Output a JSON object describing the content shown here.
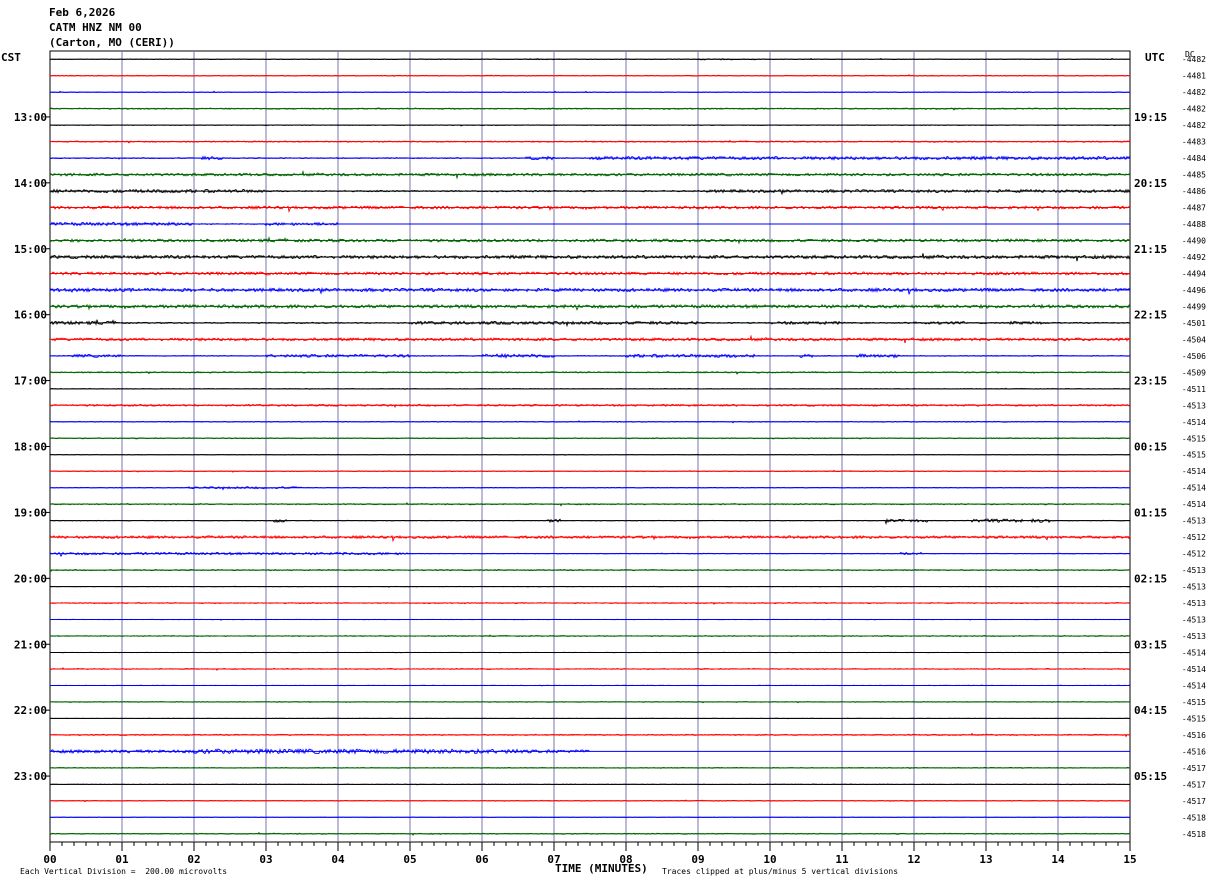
{
  "header": {
    "date": "Feb 6,2026",
    "station": "CATM HNZ NM 00",
    "location": "(Carton, MO (CERI))"
  },
  "axis_labels": {
    "left_tz": "CST",
    "right_tz": "UTC",
    "dc_label": "DC",
    "x_title": "TIME (MINUTES)",
    "scale_note": "Each Vertical Division =  200.00 microvolts",
    "clip_note": "Traces clipped at plus/minus 5 vertical divisions"
  },
  "colors": {
    "trace_cycle": [
      "#000000",
      "#ff0000",
      "#0000ff",
      "#006400"
    ],
    "grid_vertical": "#7777aa",
    "frame": "#000000"
  },
  "chart_data": {
    "type": "line",
    "description_of_series": "helicorder traces, one per 15-minute row",
    "xlim": [
      0,
      15
    ],
    "x_ticks": [
      "00",
      "01",
      "02",
      "03",
      "04",
      "05",
      "06",
      "07",
      "08",
      "09",
      "10",
      "11",
      "12",
      "13",
      "14",
      "15"
    ],
    "left_time_labels": [
      {
        "row": 4,
        "text": "13:00"
      },
      {
        "row": 8,
        "text": "14:00"
      },
      {
        "row": 12,
        "text": "15:00"
      },
      {
        "row": 16,
        "text": "16:00"
      },
      {
        "row": 20,
        "text": "17:00"
      },
      {
        "row": 24,
        "text": "18:00"
      },
      {
        "row": 28,
        "text": "19:00"
      },
      {
        "row": 32,
        "text": "20:00"
      },
      {
        "row": 36,
        "text": "21:00"
      },
      {
        "row": 40,
        "text": "22:00"
      },
      {
        "row": 44,
        "text": "23:00"
      }
    ],
    "right_time_labels": [
      {
        "row": 4,
        "text": "19:15"
      },
      {
        "row": 8,
        "text": "20:15"
      },
      {
        "row": 12,
        "text": "21:15"
      },
      {
        "row": 16,
        "text": "22:15"
      },
      {
        "row": 20,
        "text": "23:15"
      },
      {
        "row": 24,
        "text": "00:15"
      },
      {
        "row": 28,
        "text": "01:15"
      },
      {
        "row": 32,
        "text": "02:15"
      },
      {
        "row": 36,
        "text": "03:15"
      },
      {
        "row": 40,
        "text": "04:15"
      },
      {
        "row": 44,
        "text": "05:15"
      }
    ],
    "dc_offsets": [
      "-4482",
      "-4481",
      "-4482",
      "-4482",
      "-4482",
      "-4483",
      "-4484",
      "-4485",
      "-4486",
      "-4487",
      "-4488",
      "-4490",
      "-4492",
      "-4494",
      "-4496",
      "-4499",
      "-4501",
      "-4504",
      "-4506",
      "-4509",
      "-4511",
      "-4513",
      "-4514",
      "-4515",
      "-4515",
      "-4514",
      "-4514",
      "-4514",
      "-4513",
      "-4512",
      "-4512",
      "-4513",
      "-4513",
      "-4513",
      "-4513",
      "-4513",
      "-4514",
      "-4514",
      "-4514",
      "-4515",
      "-4515",
      "-4516",
      "-4516",
      "-4517",
      "-4517",
      "-4517",
      "-4518",
      "-4518"
    ],
    "rows": [
      {
        "noise": 0.3,
        "events": [
          [
            6.6,
            7.0,
            0.6
          ],
          [
            9.0,
            9.8,
            0.6
          ]
        ],
        "end": 15
      },
      {
        "noise": 0.4,
        "events": [],
        "end": 15
      },
      {
        "noise": 0.3,
        "events": [
          [
            13.0,
            13.6,
            0.5
          ]
        ],
        "end": 15
      },
      {
        "noise": 0.6,
        "events": [],
        "end": 15
      },
      {
        "noise": 0.3,
        "events": [],
        "end": 15
      },
      {
        "noise": 0.6,
        "events": [],
        "end": 15
      },
      {
        "noise": 0.5,
        "events": [
          [
            2.1,
            2.4,
            1.6
          ],
          [
            6.6,
            7.0,
            1.6
          ],
          [
            7.5,
            15.0,
            1.6
          ]
        ],
        "end": 15
      },
      {
        "noise": 1.3,
        "events": [],
        "end": 15
      },
      {
        "noise": 0.7,
        "events": [
          [
            0.0,
            3.0,
            1.6
          ],
          [
            9.0,
            15.0,
            1.4
          ]
        ],
        "end": 15
      },
      {
        "noise": 1.4,
        "events": [],
        "end": 15
      },
      {
        "noise": 0.5,
        "events": [
          [
            0.0,
            2.0,
            1.6
          ],
          [
            3.0,
            4.0,
            1.4
          ]
        ],
        "end": 4.0
      },
      {
        "noise": 1.4,
        "events": [],
        "end": 15
      },
      {
        "noise": 1.6,
        "events": [],
        "end": 15
      },
      {
        "noise": 1.4,
        "events": [],
        "end": 15
      },
      {
        "noise": 1.6,
        "events": [],
        "end": 15
      },
      {
        "noise": 1.6,
        "events": [],
        "end": 15
      },
      {
        "noise": 0.6,
        "events": [
          [
            0.0,
            1.0,
            1.6
          ],
          [
            5.0,
            9.0,
            1.5
          ],
          [
            10.0,
            11.0,
            1.4
          ],
          [
            12.0,
            12.7,
            1.4
          ],
          [
            13.3,
            13.8,
            1.5
          ]
        ],
        "end": 15
      },
      {
        "noise": 1.4,
        "events": [],
        "end": 15
      },
      {
        "noise": 0.4,
        "events": [
          [
            0.3,
            1.0,
            1.4
          ],
          [
            3.0,
            5.0,
            1.4
          ],
          [
            6.0,
            7.0,
            1.8
          ],
          [
            8.0,
            9.8,
            1.6
          ],
          [
            10.4,
            10.6,
            1.6
          ],
          [
            11.2,
            11.8,
            1.8
          ]
        ],
        "end": 15
      },
      {
        "noise": 0.6,
        "events": [],
        "end": 15
      },
      {
        "noise": 0.3,
        "events": [],
        "end": 15
      },
      {
        "noise": 0.9,
        "events": [],
        "end": 15
      },
      {
        "noise": 0.4,
        "events": [],
        "end": 15
      },
      {
        "noise": 0.5,
        "events": [],
        "end": 15
      },
      {
        "noise": 0.2,
        "events": [],
        "end": 15
      },
      {
        "noise": 0.4,
        "events": [],
        "end": 15
      },
      {
        "noise": 0.3,
        "events": [
          [
            1.9,
            3.5,
            1.0
          ]
        ],
        "end": 15
      },
      {
        "noise": 0.6,
        "events": [],
        "end": 15
      },
      {
        "noise": 0.3,
        "events": [
          [
            3.1,
            3.3,
            1.6
          ],
          [
            6.9,
            7.1,
            1.4
          ],
          [
            11.6,
            12.2,
            1.4
          ],
          [
            12.8,
            13.5,
            1.6
          ],
          [
            13.6,
            13.9,
            1.6
          ]
        ],
        "end": 15
      },
      {
        "noise": 1.3,
        "events": [],
        "end": 15
      },
      {
        "noise": 0.3,
        "events": [
          [
            0.0,
            5.0,
            1.2
          ],
          [
            11.8,
            12.1,
            1.2
          ]
        ],
        "end": 15
      },
      {
        "noise": 0.6,
        "events": [],
        "end": 15
      },
      {
        "noise": 0.2,
        "events": [],
        "end": 15
      },
      {
        "noise": 0.5,
        "events": [],
        "end": 15
      },
      {
        "noise": 0.2,
        "events": [],
        "end": 15
      },
      {
        "noise": 0.5,
        "events": [],
        "end": 15
      },
      {
        "noise": 0.2,
        "events": [],
        "end": 15
      },
      {
        "noise": 0.5,
        "events": [],
        "end": 15
      },
      {
        "noise": 0.2,
        "events": [],
        "end": 15
      },
      {
        "noise": 0.4,
        "events": [],
        "end": 15
      },
      {
        "noise": 0.2,
        "events": [],
        "end": 15
      },
      {
        "noise": 0.6,
        "events": [],
        "end": 15
      },
      {
        "noise": 1.5,
        "events": [
          [
            2.0,
            6.5,
            2.2
          ]
        ],
        "end": 7.5
      },
      {
        "noise": 0.4,
        "events": [],
        "end": 15
      },
      {
        "noise": 0.2,
        "events": [],
        "end": 15
      },
      {
        "noise": 0.4,
        "events": [],
        "end": 15
      },
      {
        "noise": 0.2,
        "events": [],
        "end": 15
      },
      {
        "noise": 0.5,
        "events": [],
        "end": 15
      }
    ]
  }
}
